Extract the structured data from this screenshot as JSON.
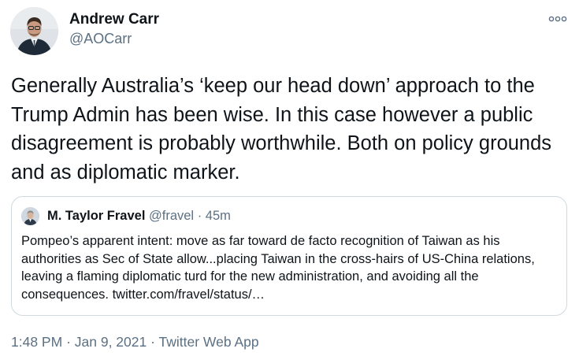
{
  "author": {
    "name": "Andrew Carr",
    "handle": "@AOCarr",
    "avatar_icon": "profile-photo"
  },
  "more_menu_icon": "more-horizontal-icon",
  "tweet": {
    "text": "Generally Australia’s ‘keep our head down’ approach to the Trump Admin has been wise. In this case however a public disagreement is probably worthwhile. Both on policy grounds and as diplomatic marker."
  },
  "quote": {
    "name": "M. Taylor Fravel",
    "handle": "@fravel",
    "separator": "·",
    "time": "45m",
    "avatar_icon": "profile-photo",
    "text": "Pompeo’s apparent intent: move as far toward de facto recognition of Taiwan as his authorities as Sec of State allow...placing Taiwan in the cross-hairs of US-China relations, leaving a flaming diplomatic turd for the new administration, and avoiding all the consequences. twitter.com/fravel/status/…"
  },
  "footer": {
    "time": "1:48 PM",
    "separator1": "·",
    "date": "Jan 9, 2021",
    "separator2": "·",
    "source": "Twitter Web App"
  },
  "colors": {
    "text_primary": "#0f1419",
    "text_secondary": "#5b7083",
    "border": "#cfd9de"
  }
}
